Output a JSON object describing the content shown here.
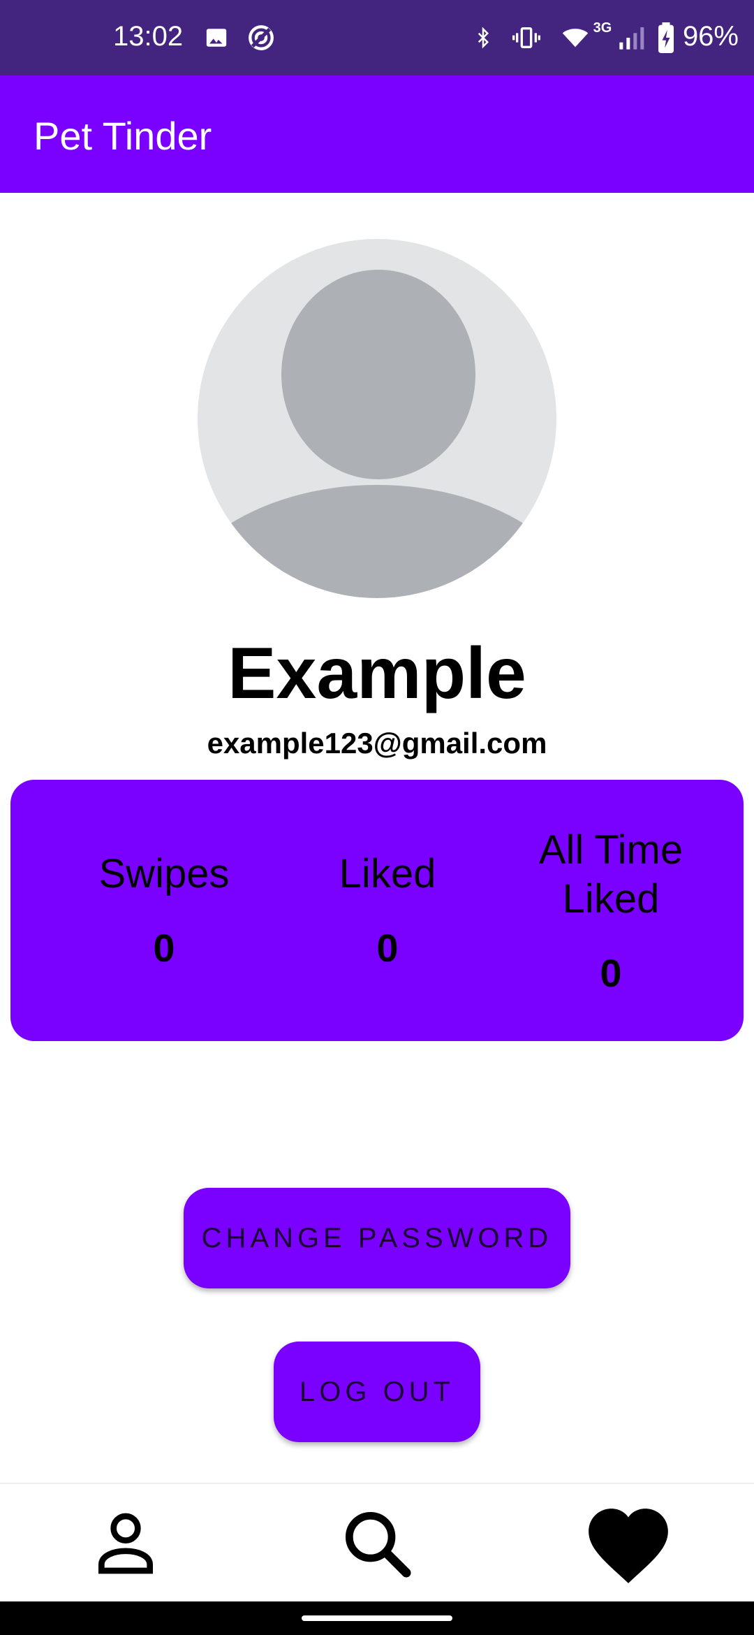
{
  "status_bar": {
    "time": "13:02",
    "network": "3G",
    "battery": "96%",
    "icons": [
      "image-icon",
      "sync-icon",
      "bluetooth-icon",
      "vibrate-icon",
      "wifi-icon",
      "signal-icon",
      "battery-charging-icon"
    ]
  },
  "app_bar": {
    "title": "Pet Tinder"
  },
  "profile": {
    "name": "Example",
    "email": "example123@gmail.com",
    "avatar_icon": "default-avatar-icon"
  },
  "stats": [
    {
      "label": "Swipes",
      "value": "0"
    },
    {
      "label": "Liked",
      "value": "0"
    },
    {
      "label": "All Time Liked",
      "value": "0"
    }
  ],
  "buttons": {
    "change_password": "CHANGE PASSWORD",
    "log_out": "LOG OUT"
  },
  "bottom_nav": [
    {
      "icon": "person-icon"
    },
    {
      "icon": "search-icon"
    },
    {
      "icon": "heart-icon"
    }
  ],
  "colors": {
    "status_bar": "#43247f",
    "primary": "#7a00ff",
    "avatar_bg": "#e2e4e6",
    "avatar_fg": "#adb0b4"
  }
}
